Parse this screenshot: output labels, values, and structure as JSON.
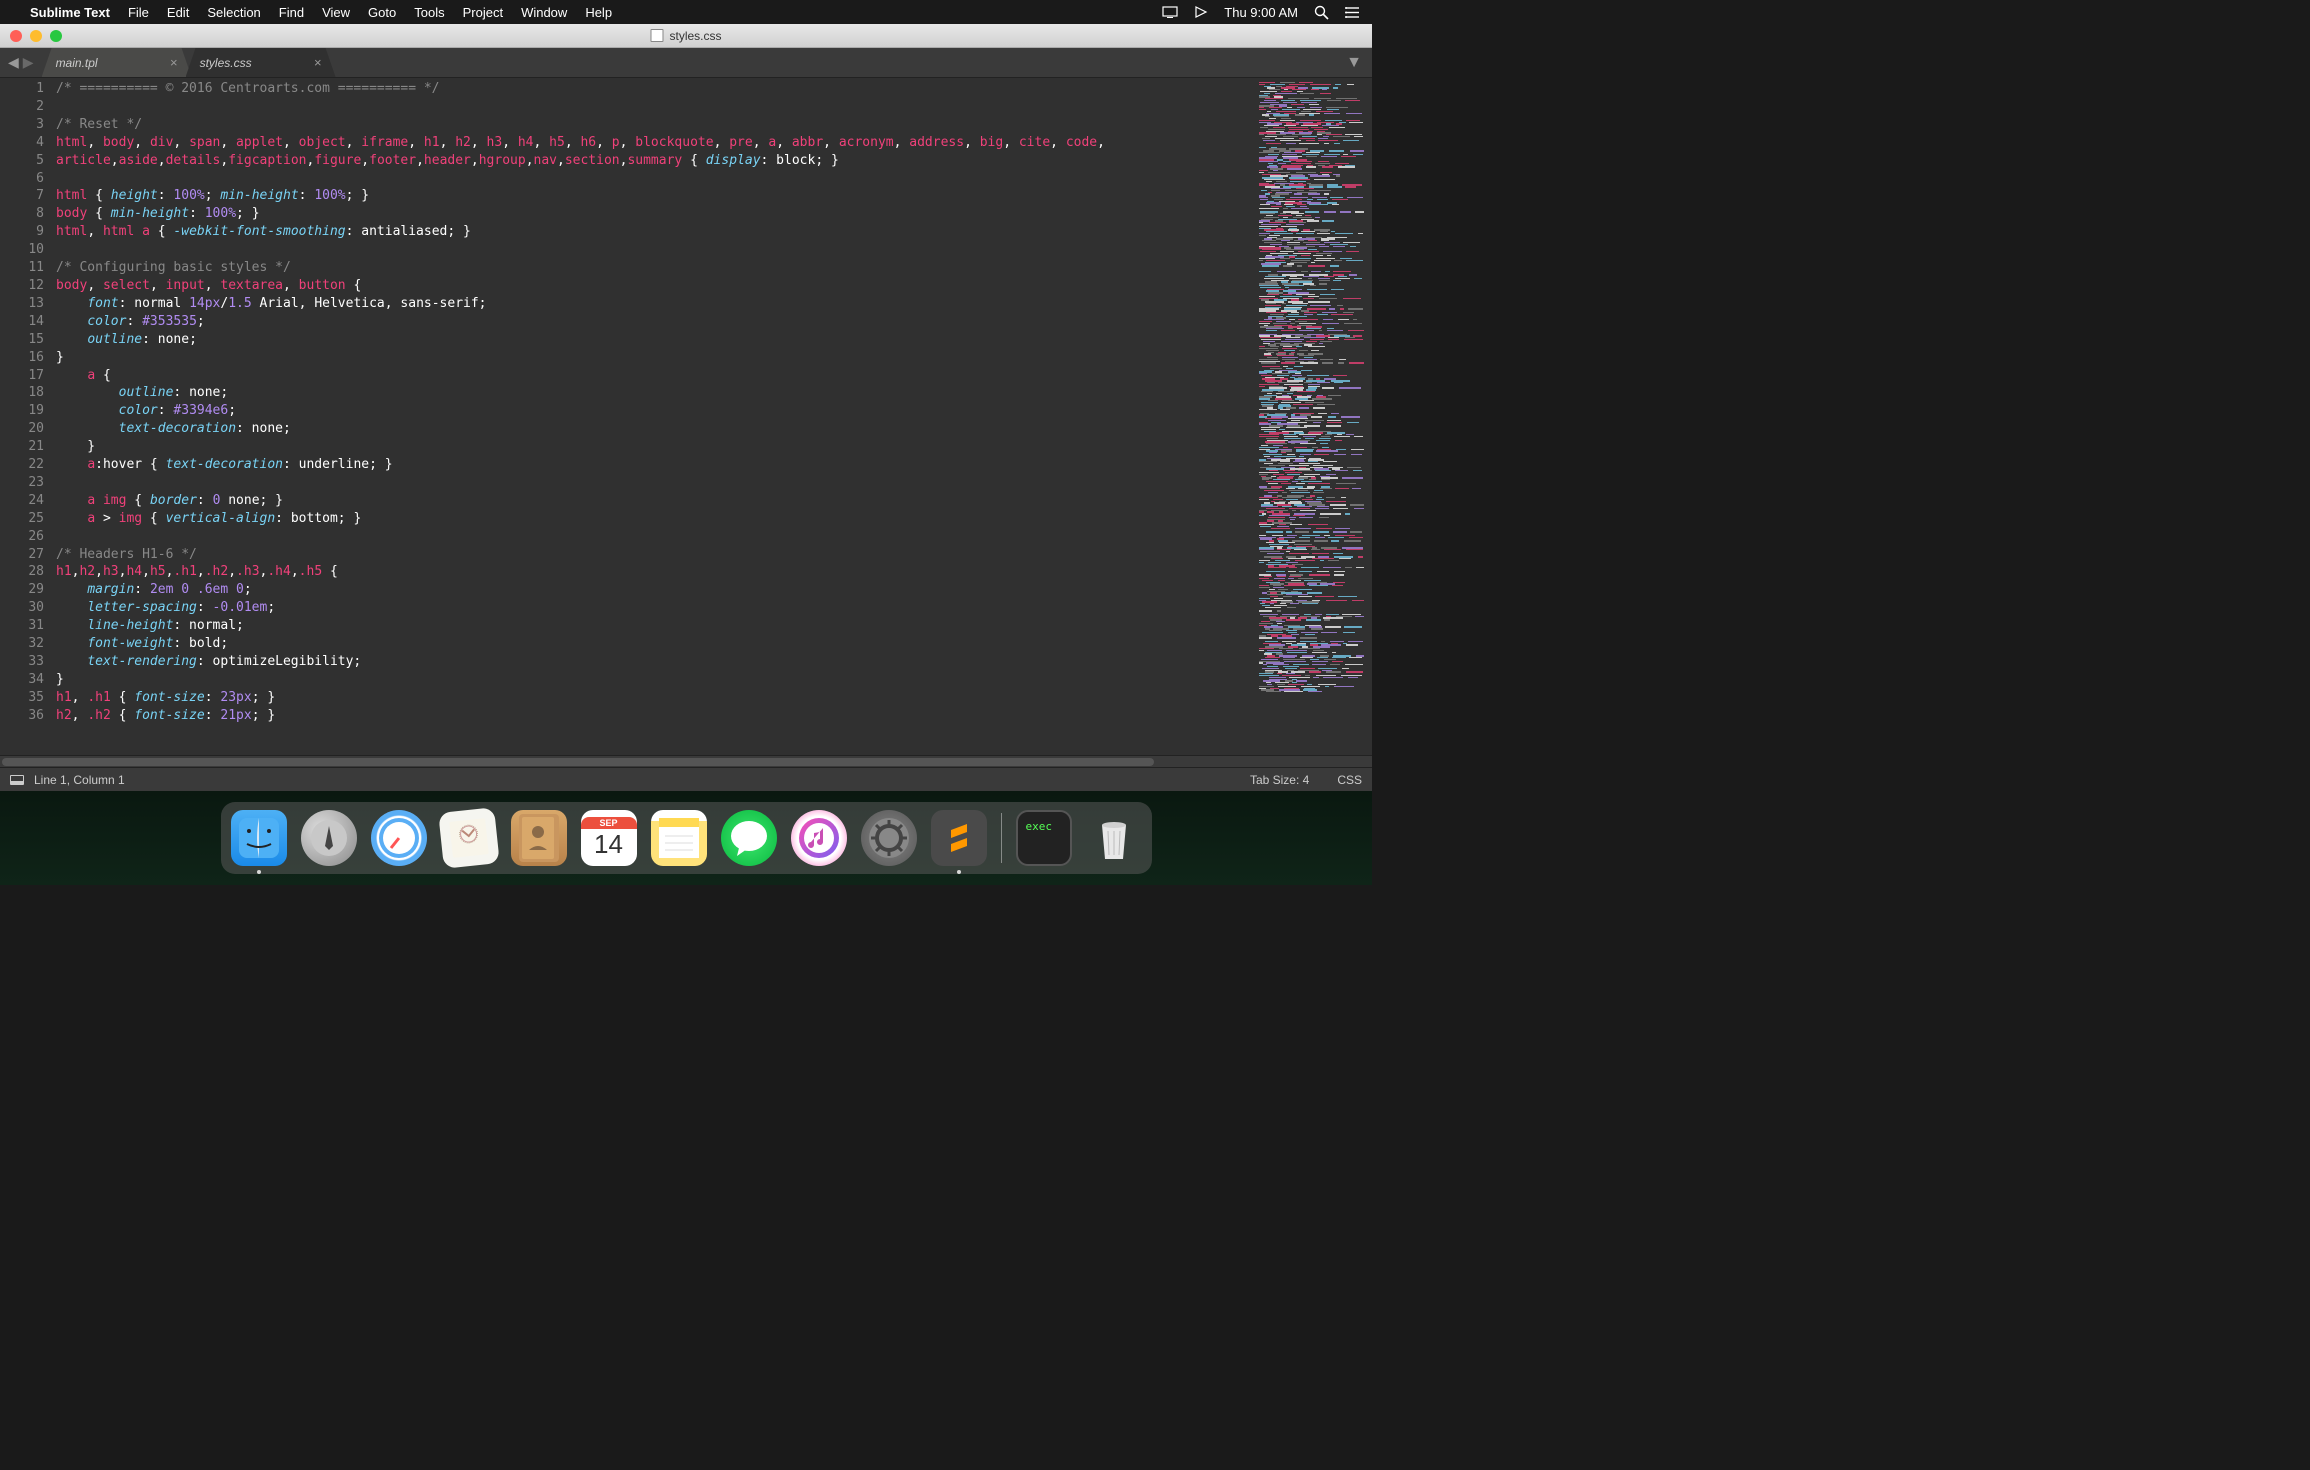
{
  "menubar": {
    "app_name": "Sublime Text",
    "items": [
      "File",
      "Edit",
      "Selection",
      "Find",
      "View",
      "Goto",
      "Tools",
      "Project",
      "Window",
      "Help"
    ],
    "clock": "Thu 9:00 AM"
  },
  "window": {
    "title": "styles.css"
  },
  "tabs": [
    {
      "label": "main.tpl",
      "active": false
    },
    {
      "label": "styles.css",
      "active": true
    }
  ],
  "code_lines": [
    [
      [
        "cm",
        "/* ========== © 2016 Centroarts.com ========== */"
      ]
    ],
    [],
    [
      [
        "cm",
        "/* Reset */"
      ]
    ],
    [
      [
        "tag",
        "html"
      ],
      [
        "w",
        ", "
      ],
      [
        "tag",
        "body"
      ],
      [
        "w",
        ", "
      ],
      [
        "tag",
        "div"
      ],
      [
        "w",
        ", "
      ],
      [
        "tag",
        "span"
      ],
      [
        "w",
        ", "
      ],
      [
        "tag",
        "applet"
      ],
      [
        "w",
        ", "
      ],
      [
        "tag",
        "object"
      ],
      [
        "w",
        ", "
      ],
      [
        "tag",
        "iframe"
      ],
      [
        "w",
        ", "
      ],
      [
        "tag",
        "h1"
      ],
      [
        "w",
        ", "
      ],
      [
        "tag",
        "h2"
      ],
      [
        "w",
        ", "
      ],
      [
        "tag",
        "h3"
      ],
      [
        "w",
        ", "
      ],
      [
        "tag",
        "h4"
      ],
      [
        "w",
        ", "
      ],
      [
        "tag",
        "h5"
      ],
      [
        "w",
        ", "
      ],
      [
        "tag",
        "h6"
      ],
      [
        "w",
        ", "
      ],
      [
        "tag",
        "p"
      ],
      [
        "w",
        ", "
      ],
      [
        "tag",
        "blockquote"
      ],
      [
        "w",
        ", "
      ],
      [
        "tag",
        "pre"
      ],
      [
        "w",
        ", "
      ],
      [
        "tag",
        "a"
      ],
      [
        "w",
        ", "
      ],
      [
        "tag",
        "abbr"
      ],
      [
        "w",
        ", "
      ],
      [
        "tag",
        "acronym"
      ],
      [
        "w",
        ", "
      ],
      [
        "tag",
        "address"
      ],
      [
        "w",
        ", "
      ],
      [
        "tag",
        "big"
      ],
      [
        "w",
        ", "
      ],
      [
        "tag",
        "cite"
      ],
      [
        "w",
        ", "
      ],
      [
        "tag",
        "code"
      ],
      [
        "w",
        ", "
      ]
    ],
    [
      [
        "tag",
        "article"
      ],
      [
        "w",
        ","
      ],
      [
        "tag",
        "aside"
      ],
      [
        "w",
        ","
      ],
      [
        "tag",
        "details"
      ],
      [
        "w",
        ","
      ],
      [
        "tag",
        "figcaption"
      ],
      [
        "w",
        ","
      ],
      [
        "tag",
        "figure"
      ],
      [
        "w",
        ","
      ],
      [
        "tag",
        "footer"
      ],
      [
        "w",
        ","
      ],
      [
        "tag",
        "header"
      ],
      [
        "w",
        ","
      ],
      [
        "tag",
        "hgroup"
      ],
      [
        "w",
        ","
      ],
      [
        "tag",
        "nav"
      ],
      [
        "w",
        ","
      ],
      [
        "tag",
        "section"
      ],
      [
        "w",
        ","
      ],
      [
        "tag",
        "summary"
      ],
      [
        "w",
        " { "
      ],
      [
        "prop",
        "display"
      ],
      [
        "w",
        ": block; }"
      ]
    ],
    [],
    [
      [
        "tag",
        "html"
      ],
      [
        "w",
        " { "
      ],
      [
        "prop",
        "height"
      ],
      [
        "w",
        ": "
      ],
      [
        "num",
        "100%"
      ],
      [
        "w",
        "; "
      ],
      [
        "prop",
        "min-height"
      ],
      [
        "w",
        ": "
      ],
      [
        "num",
        "100%"
      ],
      [
        "w",
        "; }"
      ]
    ],
    [
      [
        "tag",
        "body"
      ],
      [
        "w",
        " { "
      ],
      [
        "prop",
        "min-height"
      ],
      [
        "w",
        ": "
      ],
      [
        "num",
        "100%"
      ],
      [
        "w",
        "; }"
      ]
    ],
    [
      [
        "tag",
        "html"
      ],
      [
        "w",
        ", "
      ],
      [
        "tag",
        "html"
      ],
      [
        "w",
        " "
      ],
      [
        "tag",
        "a"
      ],
      [
        "w",
        " { "
      ],
      [
        "prop",
        "-webkit-font-smoothing"
      ],
      [
        "w",
        ": antialiased; }"
      ]
    ],
    [],
    [
      [
        "cm",
        "/* Configuring basic styles */"
      ]
    ],
    [
      [
        "tag",
        "body"
      ],
      [
        "w",
        ", "
      ],
      [
        "tag",
        "select"
      ],
      [
        "w",
        ", "
      ],
      [
        "tag",
        "input"
      ],
      [
        "w",
        ", "
      ],
      [
        "tag",
        "textarea"
      ],
      [
        "w",
        ", "
      ],
      [
        "tag",
        "button"
      ],
      [
        "w",
        " {"
      ]
    ],
    [
      [
        "w",
        "    "
      ],
      [
        "prop",
        "font"
      ],
      [
        "w",
        ": normal "
      ],
      [
        "num",
        "14px"
      ],
      [
        "w",
        "/"
      ],
      [
        "num",
        "1.5"
      ],
      [
        "w",
        " Arial, Helvetica, sans-serif;"
      ]
    ],
    [
      [
        "w",
        "    "
      ],
      [
        "prop",
        "color"
      ],
      [
        "w",
        ": "
      ],
      [
        "num",
        "#353535"
      ],
      [
        "w",
        ";"
      ]
    ],
    [
      [
        "w",
        "    "
      ],
      [
        "prop",
        "outline"
      ],
      [
        "w",
        ": none;"
      ]
    ],
    [
      [
        "w",
        "}"
      ]
    ],
    [
      [
        "w",
        "    "
      ],
      [
        "tag",
        "a"
      ],
      [
        "w",
        " {"
      ]
    ],
    [
      [
        "w",
        "        "
      ],
      [
        "prop",
        "outline"
      ],
      [
        "w",
        ": none;"
      ]
    ],
    [
      [
        "w",
        "        "
      ],
      [
        "prop",
        "color"
      ],
      [
        "w",
        ": "
      ],
      [
        "num",
        "#3394e6"
      ],
      [
        "w",
        ";"
      ]
    ],
    [
      [
        "w",
        "        "
      ],
      [
        "prop",
        "text-decoration"
      ],
      [
        "w",
        ": none;"
      ]
    ],
    [
      [
        "w",
        "    }"
      ]
    ],
    [
      [
        "w",
        "    "
      ],
      [
        "tag",
        "a"
      ],
      [
        "w",
        ":hover { "
      ],
      [
        "prop",
        "text-decoration"
      ],
      [
        "w",
        ": underline; }"
      ]
    ],
    [],
    [
      [
        "w",
        "    "
      ],
      [
        "tag",
        "a"
      ],
      [
        "w",
        " "
      ],
      [
        "tag",
        "img"
      ],
      [
        "w",
        " { "
      ],
      [
        "prop",
        "border"
      ],
      [
        "w",
        ": "
      ],
      [
        "num",
        "0"
      ],
      [
        "w",
        " none; }"
      ]
    ],
    [
      [
        "w",
        "    "
      ],
      [
        "tag",
        "a"
      ],
      [
        "w",
        " > "
      ],
      [
        "tag",
        "img"
      ],
      [
        "w",
        " { "
      ],
      [
        "prop",
        "vertical-align"
      ],
      [
        "w",
        ": bottom; }"
      ]
    ],
    [],
    [
      [
        "cm",
        "/* Headers H1-6 */"
      ]
    ],
    [
      [
        "tag",
        "h1"
      ],
      [
        "w",
        ","
      ],
      [
        "tag",
        "h2"
      ],
      [
        "w",
        ","
      ],
      [
        "tag",
        "h3"
      ],
      [
        "w",
        ","
      ],
      [
        "tag",
        "h4"
      ],
      [
        "w",
        ","
      ],
      [
        "tag",
        "h5"
      ],
      [
        "w",
        ","
      ],
      [
        "tag",
        ".h1"
      ],
      [
        "w",
        ","
      ],
      [
        "tag",
        ".h2"
      ],
      [
        "w",
        ","
      ],
      [
        "tag",
        ".h3"
      ],
      [
        "w",
        ","
      ],
      [
        "tag",
        ".h4"
      ],
      [
        "w",
        ","
      ],
      [
        "tag",
        ".h5"
      ],
      [
        "w",
        " {"
      ]
    ],
    [
      [
        "w",
        "    "
      ],
      [
        "prop",
        "margin"
      ],
      [
        "w",
        ": "
      ],
      [
        "num",
        "2em"
      ],
      [
        "w",
        " "
      ],
      [
        "num",
        "0"
      ],
      [
        "w",
        " "
      ],
      [
        "num",
        ".6em"
      ],
      [
        "w",
        " "
      ],
      [
        "num",
        "0"
      ],
      [
        "w",
        ";"
      ]
    ],
    [
      [
        "w",
        "    "
      ],
      [
        "prop",
        "letter-spacing"
      ],
      [
        "w",
        ": "
      ],
      [
        "num",
        "-0.01em"
      ],
      [
        "w",
        ";"
      ]
    ],
    [
      [
        "w",
        "    "
      ],
      [
        "prop",
        "line-height"
      ],
      [
        "w",
        ": normal;"
      ]
    ],
    [
      [
        "w",
        "    "
      ],
      [
        "prop",
        "font-weight"
      ],
      [
        "w",
        ": bold;"
      ]
    ],
    [
      [
        "w",
        "    "
      ],
      [
        "prop",
        "text-rendering"
      ],
      [
        "w",
        ": optimizeLegibility;"
      ]
    ],
    [
      [
        "w",
        "}"
      ]
    ],
    [
      [
        "tag",
        "h1"
      ],
      [
        "w",
        ", "
      ],
      [
        "tag",
        ".h1"
      ],
      [
        "w",
        " { "
      ],
      [
        "prop",
        "font-size"
      ],
      [
        "w",
        ": "
      ],
      [
        "num",
        "23px"
      ],
      [
        "w",
        "; }"
      ]
    ],
    [
      [
        "tag",
        "h2"
      ],
      [
        "w",
        ", "
      ],
      [
        "tag",
        ".h2"
      ],
      [
        "w",
        " { "
      ],
      [
        "prop",
        "font-size"
      ],
      [
        "w",
        ": "
      ],
      [
        "num",
        "21px"
      ],
      [
        "w",
        "; }"
      ]
    ]
  ],
  "statusbar": {
    "position": "Line 1, Column 1",
    "tab_size": "Tab Size: 4",
    "syntax": "CSS"
  },
  "dock": {
    "calendar_month": "SEP",
    "calendar_day": "14",
    "terminal_label": "exec"
  }
}
